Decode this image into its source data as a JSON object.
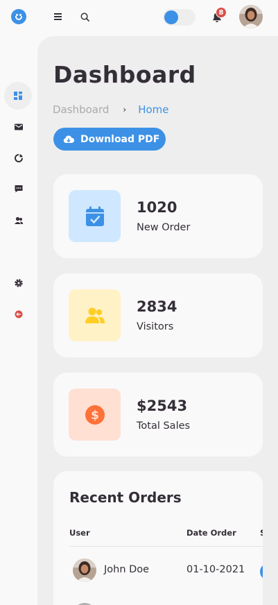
{
  "header": {
    "notification_count": "8",
    "toggle_state": "off"
  },
  "sidebar": {
    "items": [
      {
        "icon": "dashboard-icon",
        "active": true
      },
      {
        "icon": "store-icon",
        "active": false
      },
      {
        "icon": "analytics-icon",
        "active": false
      },
      {
        "icon": "message-icon",
        "active": false
      },
      {
        "icon": "team-icon",
        "active": false
      },
      {
        "icon": "settings-icon",
        "active": false
      },
      {
        "icon": "logout-icon",
        "active": false
      }
    ]
  },
  "main": {
    "title": "Dashboard",
    "breadcrumb": [
      "Dashboard",
      "Home"
    ],
    "breadcrumb_separator": "›",
    "download_label": "Download PDF"
  },
  "stats": [
    {
      "value": "1020",
      "label": "New Order",
      "icon": "calendar-check-icon",
      "bg": "#cfe8ff",
      "fg": "#3c91e6"
    },
    {
      "value": "2834",
      "label": "Visitors",
      "icon": "group-icon",
      "bg": "#fff2c6",
      "fg": "#ffce26"
    },
    {
      "value": "$2543",
      "label": "Total Sales",
      "icon": "dollar-circle-icon",
      "bg": "#ffe0d3",
      "fg": "#fd7238"
    }
  ],
  "orders": {
    "title": "Recent Orders",
    "columns": [
      "User",
      "Date Order",
      "S"
    ],
    "rows": [
      {
        "user": "John Doe",
        "date": "01-10-2021"
      }
    ]
  },
  "colors": {
    "primary": "#3c91e6",
    "dark": "#342e37",
    "light": "#f9f9f9",
    "grey": "#eeeeee",
    "red": "#db504a"
  }
}
